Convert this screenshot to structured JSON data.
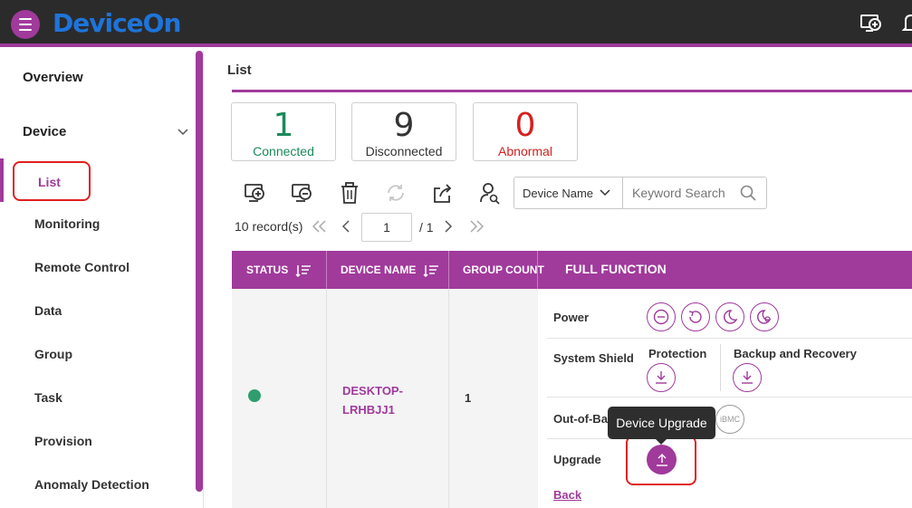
{
  "app": {
    "logo_text": "DeviceOn",
    "accent_color": "#a03a9b",
    "topbar_icons": [
      "add-device-icon",
      "bell-icon"
    ]
  },
  "sidebar": {
    "overview_label": "Overview",
    "device_label": "Device",
    "items": [
      {
        "label": "List",
        "active": true
      },
      {
        "label": "Monitoring"
      },
      {
        "label": "Remote Control"
      },
      {
        "label": "Data"
      },
      {
        "label": "Group"
      },
      {
        "label": "Task"
      },
      {
        "label": "Provision"
      },
      {
        "label": "Anomaly Detection"
      }
    ]
  },
  "page": {
    "title": "List"
  },
  "stats": [
    {
      "value": "1",
      "label": "Connected",
      "color": "#1a8a5a"
    },
    {
      "value": "9",
      "label": "Disconnected",
      "color": "#333333"
    },
    {
      "value": "0",
      "label": "Abnormal",
      "color": "#d62020"
    }
  ],
  "toolbar": {
    "icons": [
      "add-device-icon",
      "remove-device-icon",
      "delete-icon",
      "refresh-icon",
      "export-icon",
      "user-search-icon"
    ]
  },
  "search": {
    "field_select": "Device Name",
    "placeholder": "Keyword Search"
  },
  "pagination": {
    "records": "10 record(s)",
    "current_page": "1",
    "total": "/ 1"
  },
  "table": {
    "headers": {
      "status": "STATUS",
      "device_name": "DEVICE NAME",
      "group_count": "GROUP COUNT",
      "full_function": "FULL FUNCTION"
    },
    "rows": [
      {
        "status": "connected",
        "status_color": "#2e9e6e",
        "device_name_line1": "DESKTOP-",
        "device_name_line2": "LRHBJJ1",
        "group_count": "1"
      }
    ]
  },
  "functions": {
    "power_label": "Power",
    "power_icons": [
      "power-off-icon",
      "restart-icon",
      "sleep-icon",
      "hibernate-icon"
    ],
    "shield_label": "System Shield",
    "protection_label": "Protection",
    "backup_label": "Backup and Recovery",
    "oob_label": "Out-of-Band",
    "ibmc_label": "iBMC",
    "upgrade_label": "Upgrade",
    "tooltip": "Device Upgrade",
    "back_label": "Back"
  }
}
